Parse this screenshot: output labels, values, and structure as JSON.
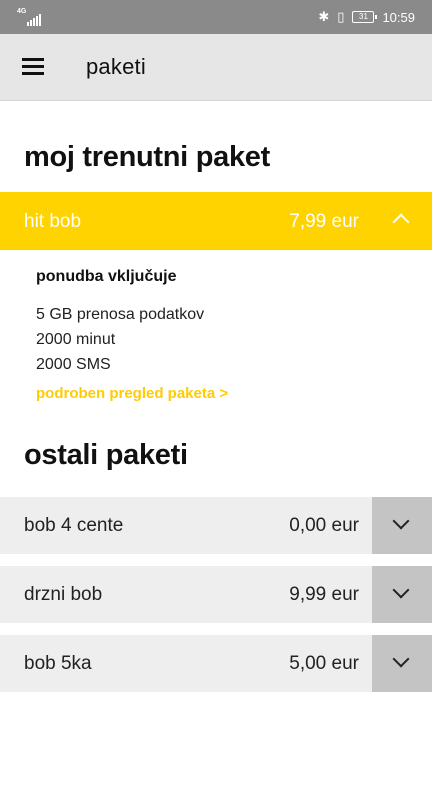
{
  "status_bar": {
    "network": "4G",
    "battery": "31",
    "time": "10:59"
  },
  "app_bar": {
    "title": "paketi"
  },
  "current": {
    "section_title": "moj trenutni paket",
    "name": "hit bob",
    "price": "7,99 eur",
    "includes_heading": "ponudba vključuje",
    "items": [
      "5 GB prenosa podatkov",
      "2000 minut",
      "2000 SMS"
    ],
    "details_link": "podroben pregled paketa >"
  },
  "others": {
    "section_title": "ostali paketi",
    "packages": [
      {
        "name": "bob 4 cente",
        "price": "0,00 eur"
      },
      {
        "name": "drzni bob",
        "price": "9,99 eur"
      },
      {
        "name": "bob 5ka",
        "price": "5,00 eur"
      }
    ]
  },
  "colors": {
    "accent": "#ffd300",
    "status_bar": "#8a8a8a",
    "app_bar": "#e6e6e6"
  }
}
